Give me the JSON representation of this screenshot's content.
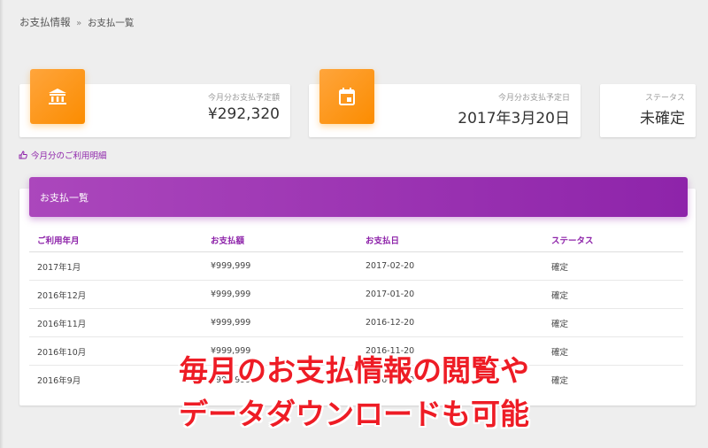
{
  "breadcrumb": {
    "parent": "お支払情報",
    "separator": "»",
    "current": "お支払一覧"
  },
  "stats": [
    {
      "icon": "bank-icon",
      "label": "今月分お支払予定額",
      "value": "¥292,320"
    },
    {
      "icon": "calendar-icon",
      "label": "今月分お支払予定日",
      "value": "2017年3月20日"
    },
    {
      "label": "ステータス",
      "value": "未確定"
    }
  ],
  "detail_link": {
    "icon": "hand-pointer-icon",
    "label": "今月分のご利用明細"
  },
  "payment_list": {
    "title": "お支払一覧",
    "columns": [
      "ご利用年月",
      "お支払額",
      "お支払日",
      "ステータス"
    ],
    "rows": [
      [
        "2017年1月",
        "¥999,999",
        "2017-02-20",
        "確定"
      ],
      [
        "2016年12月",
        "¥999,999",
        "2017-01-20",
        "確定"
      ],
      [
        "2016年11月",
        "¥999,999",
        "2016-12-20",
        "確定"
      ],
      [
        "2016年10月",
        "¥999,999",
        "2016-11-20",
        "確定"
      ],
      [
        "2016年9月",
        "¥999,999",
        "2016-10-20",
        "確定"
      ]
    ]
  },
  "overlay_caption": {
    "line1": "毎月のお支払情報の閲覧や",
    "line2": "データダウンロードも可能"
  },
  "colors": {
    "accent_purple": "#8e24aa",
    "accent_orange": "#fb8c00",
    "caption_red": "#ee1c25"
  }
}
